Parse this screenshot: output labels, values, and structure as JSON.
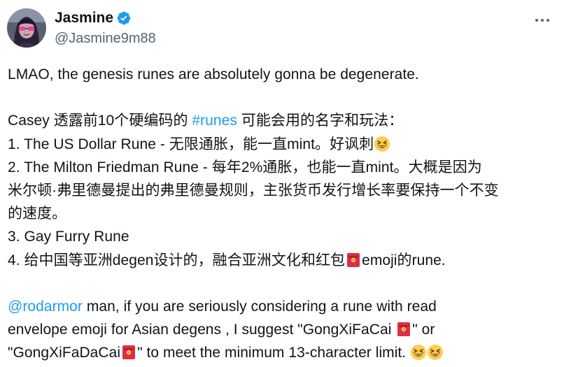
{
  "author": {
    "display_name": "Jasmine",
    "handle": "@Jasmine9m88",
    "verified": true,
    "accent": "#1d9bf0"
  },
  "tweet": {
    "line1": "LMAO, the genesis runes are absolutely gonna be degenerate.",
    "line2_a": "Casey 透露前10个硬编码的 ",
    "line2_tag": "#runes",
    "line2_b": " 可能会用的名字和玩法：",
    "line3": "1. The US Dollar Rune - 无限通胀，能一直mint。好讽刺",
    "line4": "2. The Milton Friedman Rune - 每年2%通胀，也能一直mint。大概是因为",
    "line5": "米尔顿·弗里德曼提出的弗里德曼规则，主张货币发行增长率要保持一个不变",
    "line6": "的速度。",
    "line7": "3. Gay Furry Rune",
    "line8_a": "4. 给中国等亚洲degen设计的，融合亚洲文化和红包",
    "line8_b": "emoji的rune.",
    "line9_mention": "@rodarmor",
    "line9_b": " man, if you are seriously considering a rune with read",
    "line10_a": "envelope emoji for Asian degens , I suggest \"GongXiFaCai ",
    "line10_b": "\" or",
    "line11_a": "\"GongXiFaDaCai",
    "line11_b": "\" to meet the minimum 13-character limit. "
  },
  "icons": {
    "more": "more-horizontal-icon",
    "verified": "verified-badge-icon",
    "grin": "grinning-squinting-face-emoji",
    "red_envelope": "red-envelope-emoji"
  }
}
